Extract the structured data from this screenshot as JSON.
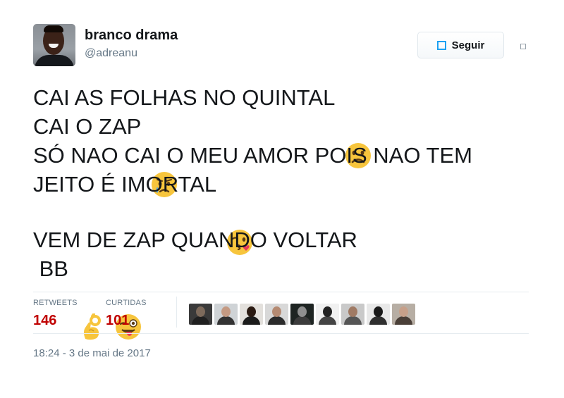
{
  "user": {
    "name": "branco drama",
    "handle": "@adreanu"
  },
  "follow_button": {
    "label": "Seguir",
    "icon": "follow-icon"
  },
  "tweet": {
    "lines": [
      {
        "text": "CAI AS FOLHAS NO QUINTAL",
        "emojis": [
          "frowning-face"
        ]
      },
      {
        "text": "CAI O ZAP",
        "emojis": [
          "crying-face"
        ]
      },
      {
        "text": "SÓ NAO CAI O MEU AMOR POIS NAO TEM",
        "emojis": []
      },
      {
        "text": "JEITO É IMORTAL",
        "emojis": [
          "face-blowing-kiss"
        ]
      },
      {
        "text": "",
        "emojis": []
      },
      {
        "text": "VEM DE ZAP QUANDO VOLTAR",
        "emojis": []
      },
      {
        "text": " BB",
        "emojis": [
          "ok-hand",
          "winking-face-tongue"
        ]
      }
    ]
  },
  "stats": {
    "retweets_label": "RETWEETS",
    "retweets_count": "146",
    "likes_label": "CURTIDAS",
    "likes_count": "101"
  },
  "liker_avatars": [
    {
      "bg": "#3a3a3a",
      "head": "#7d6a5b",
      "body": "#202020"
    },
    {
      "bg": "#cfd3d6",
      "head": "#c49a83",
      "body": "#333333"
    },
    {
      "bg": "#e3e0dc",
      "head": "#2a1a12",
      "body": "#1b1b1b"
    },
    {
      "bg": "#d8d8d8",
      "head": "#b58a72",
      "body": "#2b2b2b"
    },
    {
      "bg": "#1e2422",
      "head": "#8f8f8f",
      "body": "#3c3c3c"
    },
    {
      "bg": "#f0f0f0",
      "head": "#222222",
      "body": "#444444"
    },
    {
      "bg": "#c9c9c9",
      "head": "#a07a64",
      "body": "#555555"
    },
    {
      "bg": "#e8e8e8",
      "head": "#1a1a1a",
      "body": "#2f2f2f"
    },
    {
      "bg": "#b7aea4",
      "head": "#c7a08a",
      "body": "#4a3f38"
    }
  ],
  "timestamp": "18:24 - 3 de mai de 2017"
}
